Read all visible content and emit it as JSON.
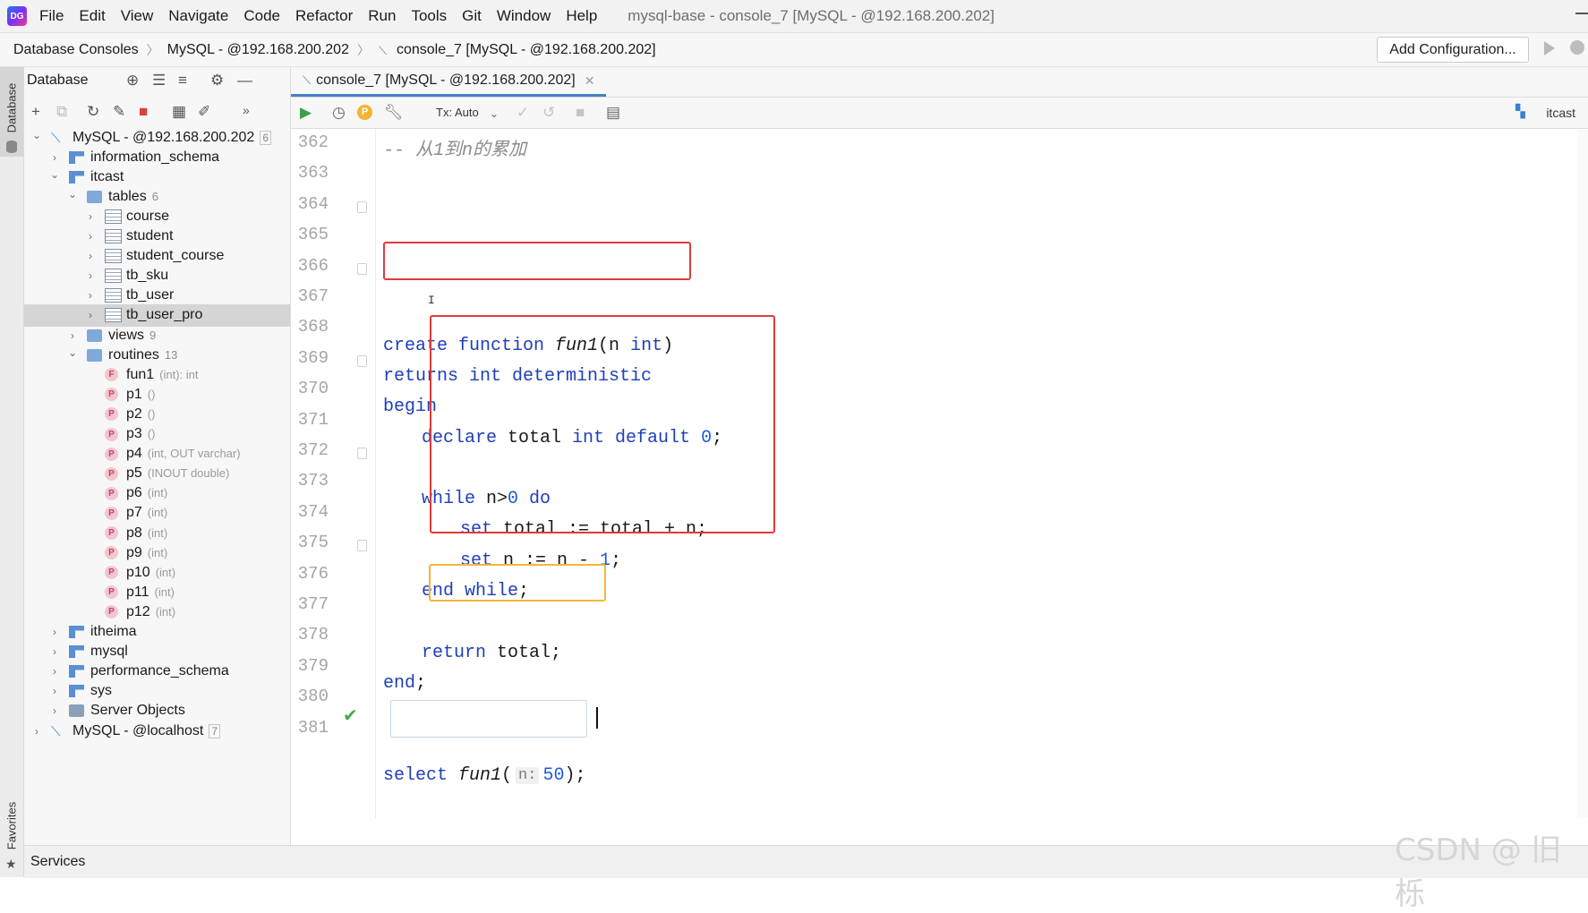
{
  "menubar": {
    "logo": "DG",
    "items": [
      "File",
      "Edit",
      "View",
      "Navigate",
      "Code",
      "Refactor",
      "Run",
      "Tools",
      "Git",
      "Window",
      "Help"
    ],
    "window_title": "mysql-base - console_7 [MySQL - @192.168.200.202]"
  },
  "navbar": {
    "breadcrumbs": [
      "Database Consoles",
      "MySQL - @192.168.200.202",
      "console_7 [MySQL - @192.168.200.202]"
    ],
    "add_config": "Add Configuration..."
  },
  "strip": {
    "database": "Database",
    "favorites": "Favorites"
  },
  "db_panel": {
    "title": "Database",
    "tree": [
      {
        "label": "MySQL - @192.168.200.202",
        "box": "6"
      },
      {
        "label": "information_schema"
      },
      {
        "label": "itcast"
      },
      {
        "label": "tables",
        "count": "6"
      },
      {
        "label": "course"
      },
      {
        "label": "student"
      },
      {
        "label": "student_course"
      },
      {
        "label": "tb_sku"
      },
      {
        "label": "tb_user"
      },
      {
        "label": "tb_user_pro"
      },
      {
        "label": "views",
        "count": "9"
      },
      {
        "label": "routines",
        "count": "13"
      },
      {
        "label": "fun1",
        "sig": "(int): int",
        "badge": "F"
      },
      {
        "label": "p1",
        "sig": "()",
        "badge": "P"
      },
      {
        "label": "p2",
        "sig": "()",
        "badge": "P"
      },
      {
        "label": "p3",
        "sig": "()",
        "badge": "P"
      },
      {
        "label": "p4",
        "sig": "(int, OUT varchar)",
        "badge": "P"
      },
      {
        "label": "p5",
        "sig": "(INOUT double)",
        "badge": "P"
      },
      {
        "label": "p6",
        "sig": "(int)",
        "badge": "P"
      },
      {
        "label": "p7",
        "sig": "(int)",
        "badge": "P"
      },
      {
        "label": "p8",
        "sig": "(int)",
        "badge": "P"
      },
      {
        "label": "p9",
        "sig": "(int)",
        "badge": "P"
      },
      {
        "label": "p10",
        "sig": "(int)",
        "badge": "P"
      },
      {
        "label": "p11",
        "sig": "(int)",
        "badge": "P"
      },
      {
        "label": "p12",
        "sig": "(int)",
        "badge": "P"
      },
      {
        "label": "itheima"
      },
      {
        "label": "mysql"
      },
      {
        "label": "performance_schema"
      },
      {
        "label": "sys"
      },
      {
        "label": "Server Objects"
      },
      {
        "label": "MySQL - @localhost",
        "box": "7"
      }
    ]
  },
  "editor": {
    "tab_label": "console_7 [MySQL - @192.168.200.202]",
    "tx_mode": "Tx: Auto",
    "schema": "itcast",
    "line_numbers": [
      "362",
      "363",
      "364",
      "365",
      "366",
      "367",
      "368",
      "369",
      "370",
      "371",
      "372",
      "373",
      "374",
      "375",
      "376",
      "377",
      "378",
      "379",
      "380",
      "381"
    ],
    "code": {
      "l362_comment": "-- 从1到n的累加",
      "l364_kw1": "create function ",
      "l364_fn": "fun1",
      "l364_rest": "(n ",
      "l364_kw2": "int",
      "l364_close": ")",
      "l365": "returns int deterministic",
      "l366": "begin",
      "l367_kw1": "declare ",
      "l367_mid": "total ",
      "l367_kw2": "int default ",
      "l367_num": "0",
      "l367_end": ";",
      "l369_kw1": "while ",
      "l369_mid": "n>",
      "l369_num": "0",
      "l369_kw2": " do",
      "l370_kw": "set ",
      "l370_rest": "total := total + n;",
      "l371_kw": "set ",
      "l371_rest": "n := n - ",
      "l371_num": "1",
      "l371_end": ";",
      "l372_kw": "end while",
      "l372_end": ";",
      "l374_kw": "return ",
      "l374_rest": "total;",
      "l375_kw": "end",
      "l375_end": ";",
      "l378_kw": "select ",
      "l378_fn": "fun1",
      "l378_open": "(",
      "l378_hint": "n:",
      "l378_num": "50",
      "l378_close": ");"
    }
  },
  "services": {
    "label": "Services"
  },
  "watermark": "CSDN @ 旧栎"
}
